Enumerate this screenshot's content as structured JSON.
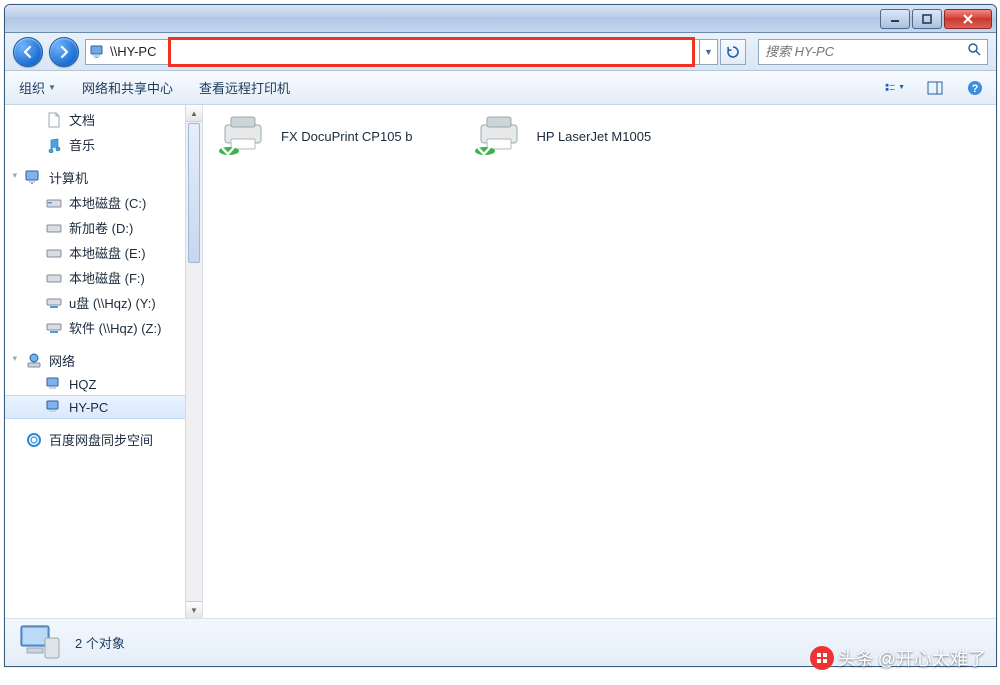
{
  "window": {
    "title": ""
  },
  "nav": {
    "address": "\\\\HY-PC"
  },
  "search": {
    "placeholder": "搜索 HY-PC"
  },
  "toolbar": {
    "organize": "组织",
    "network_center": "网络和共享中心",
    "view_remote_printers": "查看远程打印机"
  },
  "sidebar": {
    "top_items": [
      {
        "label": "文档",
        "icon": "document"
      },
      {
        "label": "音乐",
        "icon": "music"
      }
    ],
    "computer": {
      "label": "计算机",
      "items": [
        {
          "label": "本地磁盘 (C:)",
          "icon": "drive-c"
        },
        {
          "label": "新加卷 (D:)",
          "icon": "drive"
        },
        {
          "label": "本地磁盘 (E:)",
          "icon": "drive"
        },
        {
          "label": "本地磁盘 (F:)",
          "icon": "drive"
        },
        {
          "label": "u盘 (\\\\Hqz) (Y:)",
          "icon": "netdrive"
        },
        {
          "label": "软件 (\\\\Hqz) (Z:)",
          "icon": "netdrive"
        }
      ]
    },
    "network": {
      "label": "网络",
      "items": [
        {
          "label": "HQZ",
          "icon": "pc"
        },
        {
          "label": "HY-PC",
          "icon": "pc",
          "selected": true
        }
      ]
    },
    "baidu": {
      "label": "百度网盘同步空间"
    }
  },
  "content": {
    "items": [
      {
        "label": "FX DocuPrint CP105 b",
        "icon": "printer"
      },
      {
        "label": "HP LaserJet M1005",
        "icon": "printer"
      }
    ]
  },
  "status": {
    "text": "2 个对象"
  },
  "watermark": {
    "prefix": "头条",
    "handle": "@开心太难了"
  }
}
